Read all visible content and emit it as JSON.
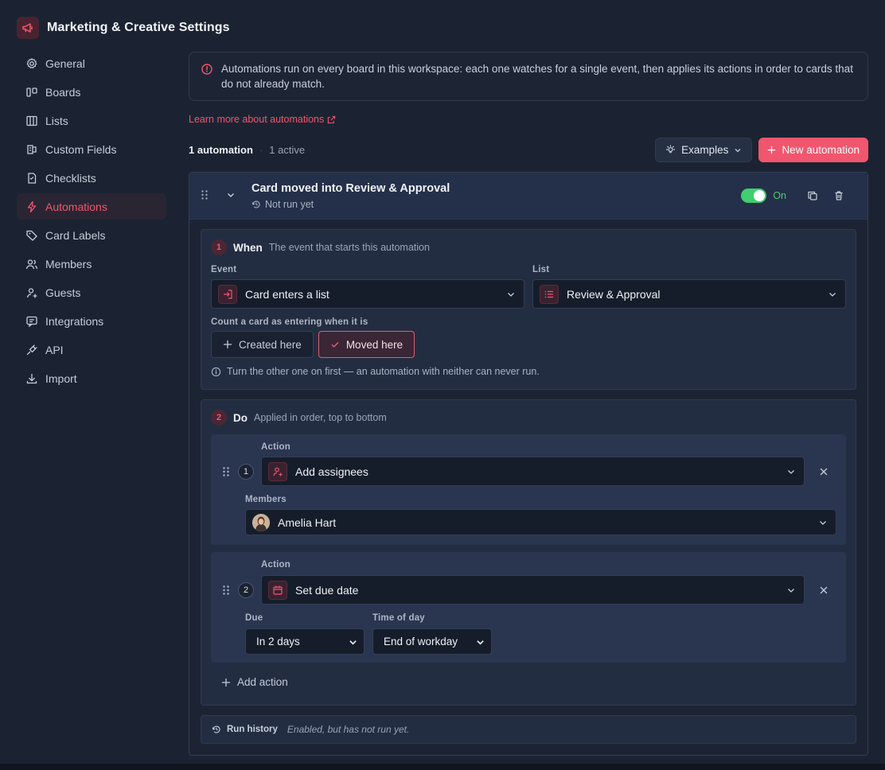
{
  "app": {
    "title": "Marketing & Creative Settings"
  },
  "sidebar": {
    "items": [
      {
        "label": "General",
        "icon": "gear-icon"
      },
      {
        "label": "Boards",
        "icon": "boards-icon"
      },
      {
        "label": "Lists",
        "icon": "columns-icon"
      },
      {
        "label": "Custom Fields",
        "icon": "custom-fields-icon"
      },
      {
        "label": "Checklists",
        "icon": "checklist-icon"
      },
      {
        "label": "Automations",
        "icon": "lightning-icon",
        "active": true
      },
      {
        "label": "Card Labels",
        "icon": "tag-icon"
      },
      {
        "label": "Members",
        "icon": "members-icon"
      },
      {
        "label": "Guests",
        "icon": "guest-icon"
      },
      {
        "label": "Integrations",
        "icon": "integrations-icon"
      },
      {
        "label": "API",
        "icon": "plug-icon"
      },
      {
        "label": "Import",
        "icon": "download-icon"
      }
    ]
  },
  "banner": {
    "text": "Automations run on every board in this workspace: each one watches for a single event, then applies its actions in order to cards that do not already match."
  },
  "learn_link": "Learn more about automations",
  "summary": {
    "count_label": "1 automation",
    "active_label": "1 active"
  },
  "toolbar": {
    "examples_label": "Examples",
    "new_label": "New automation"
  },
  "automation": {
    "title": "Card moved into Review & Approval",
    "status": "Not run yet",
    "toggle_label": "On",
    "enabled": true,
    "when": {
      "step": "1",
      "title": "When",
      "description": "The event that starts this automation",
      "event_label": "Event",
      "event_value": "Card enters a list",
      "list_label": "List",
      "list_value": "Review & Approval",
      "count_label": "Count a card as entering when it is",
      "option_created": "Created here",
      "option_moved": "Moved here",
      "hint": "Turn the other one on first — an automation with neither can never run."
    },
    "do": {
      "step": "2",
      "title": "Do",
      "description": "Applied in order, top to bottom",
      "actions": [
        {
          "num": "1",
          "action_label": "Action",
          "action_value": "Add assignees",
          "members_label": "Members",
          "member_name": "Amelia Hart"
        },
        {
          "num": "2",
          "action_label": "Action",
          "action_value": "Set due date",
          "due_label": "Due",
          "due_value": "In 2 days",
          "time_label": "Time of day",
          "time_value": "End of workday"
        }
      ],
      "add_action": "Add action"
    },
    "run_history": {
      "label": "Run history",
      "status": "Enabled, but has not run yet."
    }
  },
  "colors": {
    "accent": "#f0566d",
    "toggle_on": "#3ecf6e",
    "background": "#1b2332"
  }
}
